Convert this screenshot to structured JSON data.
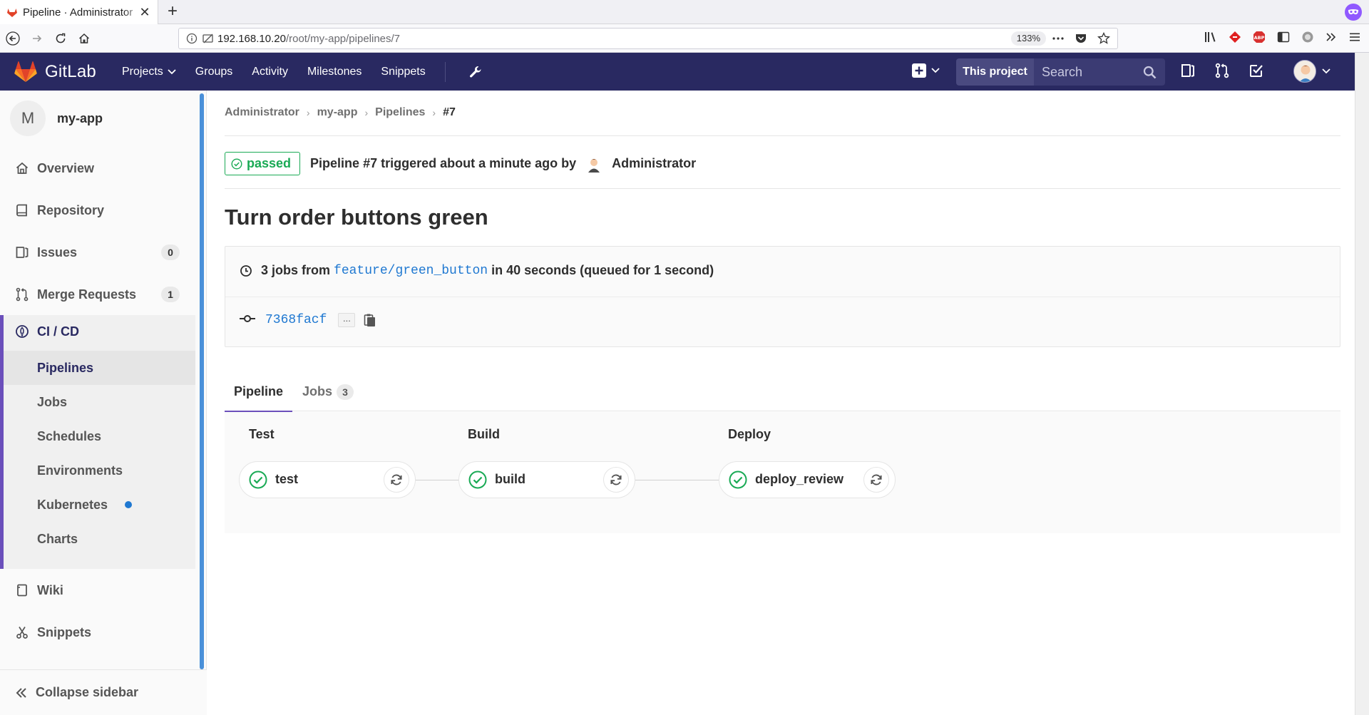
{
  "browser": {
    "tab_title": "Pipeline · Administrator",
    "url_host": "192.168.10.20",
    "url_path": "/root/my-app/pipelines/7",
    "zoom": "133%"
  },
  "header": {
    "brand": "GitLab",
    "nav": [
      "Projects",
      "Groups",
      "Activity",
      "Milestones",
      "Snippets"
    ],
    "scope_button": "This project",
    "search_placeholder": "Search",
    "colors": {
      "header_bg": "#292961",
      "accent": "#6b4fbb"
    }
  },
  "sidebar": {
    "project_initial": "M",
    "project_name": "my-app",
    "items": [
      {
        "label": "Overview",
        "icon": "home-icon"
      },
      {
        "label": "Repository",
        "icon": "book-icon"
      },
      {
        "label": "Issues",
        "icon": "issues-icon",
        "count": "0"
      },
      {
        "label": "Merge Requests",
        "icon": "merge-request-icon",
        "count": "1"
      }
    ],
    "cicd": {
      "label": "CI / CD",
      "sub": [
        "Pipelines",
        "Jobs",
        "Schedules",
        "Environments",
        "Kubernetes",
        "Charts"
      ]
    },
    "after": [
      {
        "label": "Wiki",
        "icon": "wiki-icon"
      },
      {
        "label": "Snippets",
        "icon": "scissors-icon"
      }
    ],
    "collapse_label": "Collapse sidebar"
  },
  "breadcrumb": [
    "Administrator",
    "my-app",
    "Pipelines",
    "#7"
  ],
  "pipeline": {
    "status": "passed",
    "status_color": "#1aaa55",
    "summary": "Pipeline #7 triggered about a minute ago by",
    "user": "Administrator",
    "commit_title": "Turn order buttons green",
    "jobs_prefix": "3 jobs from",
    "branch": "feature/green_button",
    "jobs_suffix": "in 40 seconds (queued for 1 second)",
    "sha": "7368facf",
    "ellipsis": "...",
    "tabs": {
      "pipeline": "Pipeline",
      "jobs": "Jobs",
      "jobs_count": "3"
    },
    "stages": [
      {
        "title": "Test",
        "job": "test"
      },
      {
        "title": "Build",
        "job": "build"
      },
      {
        "title": "Deploy",
        "job": "deploy_review"
      }
    ]
  }
}
